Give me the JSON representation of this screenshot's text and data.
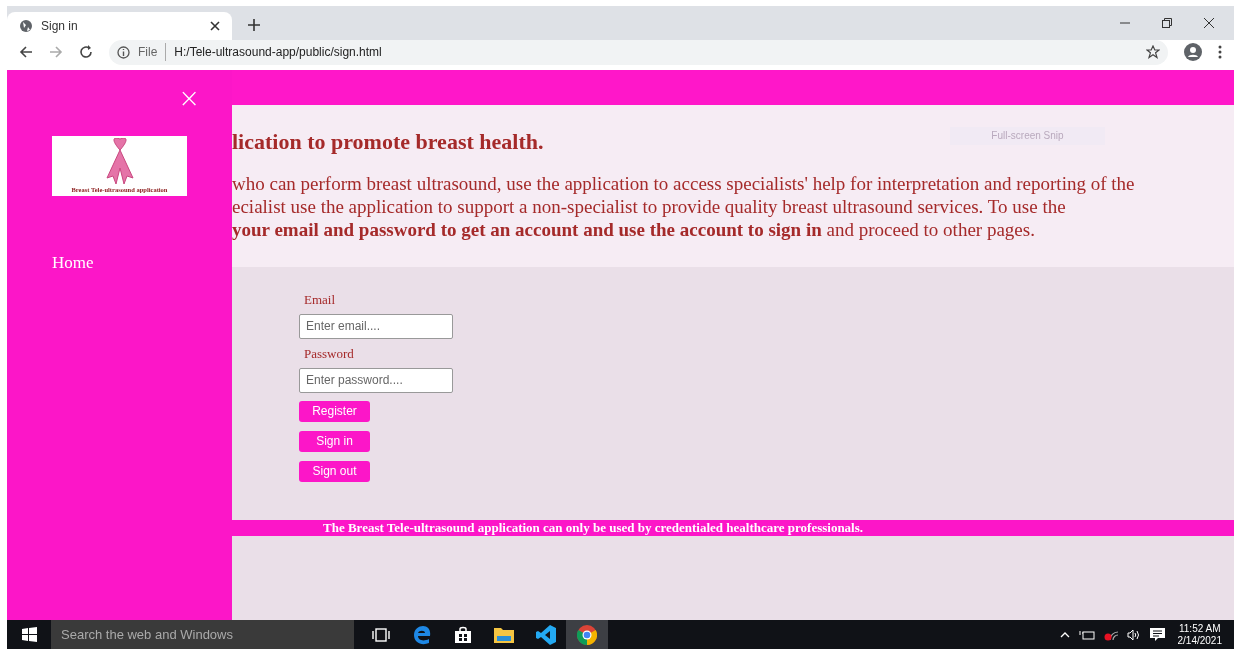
{
  "browser": {
    "tab": {
      "title": "Sign in"
    },
    "address": {
      "scheme": "File",
      "url": "H:/Tele-ultrasound-app/public/sign.html"
    }
  },
  "sidebar": {
    "close": "×",
    "logo_caption": "Breast Tele-ultrasound application",
    "items": [
      {
        "label": "Home"
      }
    ]
  },
  "intro": {
    "heading": "lication to promote breast health.",
    "lines": [
      "who can perform breast ultrasound, use the application to access specialists' help for interpretation and reporting of the",
      "ecialist use the application to support a non-specialist to provide quality breast ultrasound services. To use the",
      "**your email and password to get an account and use the account to sign in** and proceed to other pages."
    ]
  },
  "overlay_label": "Full-screen Snip",
  "form": {
    "fields": [
      {
        "label": "Email",
        "placeholder": "Enter email...."
      },
      {
        "label": "Password",
        "placeholder": "Enter password...."
      }
    ],
    "buttons": [
      "Register",
      "Sign in",
      "Sign out"
    ]
  },
  "footer": "The Breast Tele-ultrasound application can only be used by credentialed healthcare professionals.",
  "taskbar": {
    "search": {
      "placeholder": "Search the web and Windows"
    },
    "time": "11:52 AM",
    "date": "2/14/2021"
  }
}
